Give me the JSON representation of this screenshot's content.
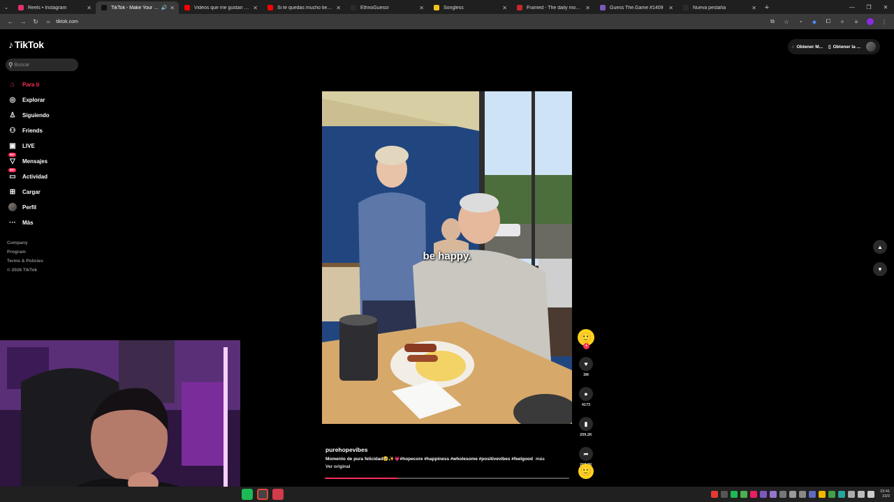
{
  "browser": {
    "tabs": [
      {
        "title": "Reels • Instagram",
        "favicon_color": "#e1306c",
        "active": false
      },
      {
        "title": "TikTok - Make Your Day",
        "favicon_color": "#111111",
        "active": true
      },
      {
        "title": "Videos que me gustan - YouTube",
        "favicon_color": "#ff0000",
        "active": false
      },
      {
        "title": "Si te quedas mucho tiempo en",
        "favicon_color": "#ff0000",
        "active": false
      },
      {
        "title": "EthnoGuessr",
        "favicon_color": "#2b2b2b",
        "active": false
      },
      {
        "title": "Songless",
        "favicon_color": "#f5c518",
        "active": false
      },
      {
        "title": "Framed - The daily movie guessing",
        "favicon_color": "#c62828",
        "active": false
      },
      {
        "title": "Guess The.Game #1409",
        "favicon_color": "#7e57c2",
        "active": false
      },
      {
        "title": "Nueva pestaña",
        "favicon_color": "#2b2b2b",
        "active": false
      }
    ],
    "new_tab_icon": "+",
    "url": "tiktok.com"
  },
  "tiktok": {
    "logo_text": "TikTok",
    "search_placeholder": "Buscar",
    "nav": [
      {
        "label": "Para ti",
        "icon": "home-icon",
        "glyph": "⌂",
        "active": true
      },
      {
        "label": "Explorar",
        "icon": "compass-icon",
        "glyph": "◎",
        "active": false
      },
      {
        "label": "Siguiendo",
        "icon": "following-icon",
        "glyph": "♙",
        "active": false
      },
      {
        "label": "Friends",
        "icon": "friends-icon",
        "glyph": "⚇",
        "active": false
      },
      {
        "label": "LIVE",
        "icon": "live-icon",
        "glyph": "▣",
        "active": false
      },
      {
        "label": "Mensajes",
        "icon": "messages-icon",
        "glyph": "▽",
        "active": false,
        "badge": "99+"
      },
      {
        "label": "Actividad",
        "icon": "activity-icon",
        "glyph": "▭",
        "active": false,
        "badge": "99+"
      },
      {
        "label": "Cargar",
        "icon": "upload-icon",
        "glyph": "⊞",
        "active": false
      },
      {
        "label": "Perfil",
        "icon": "profile-avatar",
        "glyph": "",
        "active": false
      },
      {
        "label": "Más",
        "icon": "more-icon",
        "glyph": "···",
        "active": false
      }
    ],
    "footer": [
      "Company",
      "Program",
      "Terms & Policies",
      "© 2026 TikTok"
    ],
    "top_actions": {
      "get_app": "Obtener M...",
      "get_app2": "Obtener la ..."
    },
    "video": {
      "subtitle": "be happy.",
      "author": "purehopevibes",
      "description": "Momento de pura felicidad🥹✨💗#hopecore #happiness #wholesome #positivevibes #feelgood",
      "more_label": "más",
      "original_label": "Ver original",
      "progress": 0.3
    },
    "actions": {
      "likes": "3M",
      "comments": "4173",
      "saves": "209.2K",
      "shares": "263.3K"
    }
  },
  "taskbar": {
    "time": "23:41",
    "date": "23/3"
  }
}
